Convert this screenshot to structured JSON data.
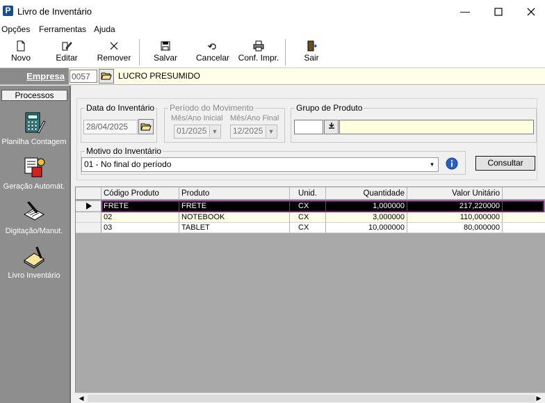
{
  "window": {
    "title": "Livro de Inventário",
    "app_icon_glyph": "P"
  },
  "menu": [
    "Opções",
    "Ferramentas",
    "Ajuda"
  ],
  "toolbar": {
    "novo": "Novo",
    "editar": "Editar",
    "remover": "Remover",
    "salvar": "Salvar",
    "cancelar": "Cancelar",
    "conf_impr": "Conf. Impr.",
    "sair": "Sair"
  },
  "empresa": {
    "label": "Empresa",
    "code": "0057",
    "name": "LUCRO PRESUMIDO"
  },
  "sidebar": {
    "header": "Processos",
    "items": [
      "Planilha Contagem",
      "Geração Automát.",
      "Digitação/Manut.",
      "Livro Inventário"
    ]
  },
  "filters": {
    "data_title": "Data do Inventário",
    "data_value": "28/04/2025",
    "periodo_title": "Período do Movimento",
    "mes_inicial_label": "Mês/Ano Inicial",
    "mes_inicial_value": "01/2025",
    "mes_final_label": "Mês/Ano Final",
    "mes_final_value": "12/2025",
    "grupo_title": "Grupo de Produto",
    "grupo_code": "",
    "grupo_name": "",
    "motivo_title": "Motivo do Inventário",
    "motivo_value": "01 - No final do período",
    "consultar": "Consultar"
  },
  "grid": {
    "columns": [
      "Código Produto",
      "Produto",
      "Unid.",
      "Quantidade",
      "Valor Unitário"
    ],
    "rows": [
      [
        "FRETE",
        "FRETE",
        "CX",
        "1,000000",
        "217,220000"
      ],
      [
        "02",
        "NOTEBOOK",
        "CX",
        "3,000000",
        "110,000000"
      ],
      [
        "03",
        "TABLET",
        "CX",
        "10,000000",
        "80,000000"
      ]
    ],
    "selected_row": 0
  },
  "colors": {
    "selected_row_bg": "#000000",
    "selected_border": "#7a1f7a",
    "empresa_bg": "#ffffe8"
  }
}
